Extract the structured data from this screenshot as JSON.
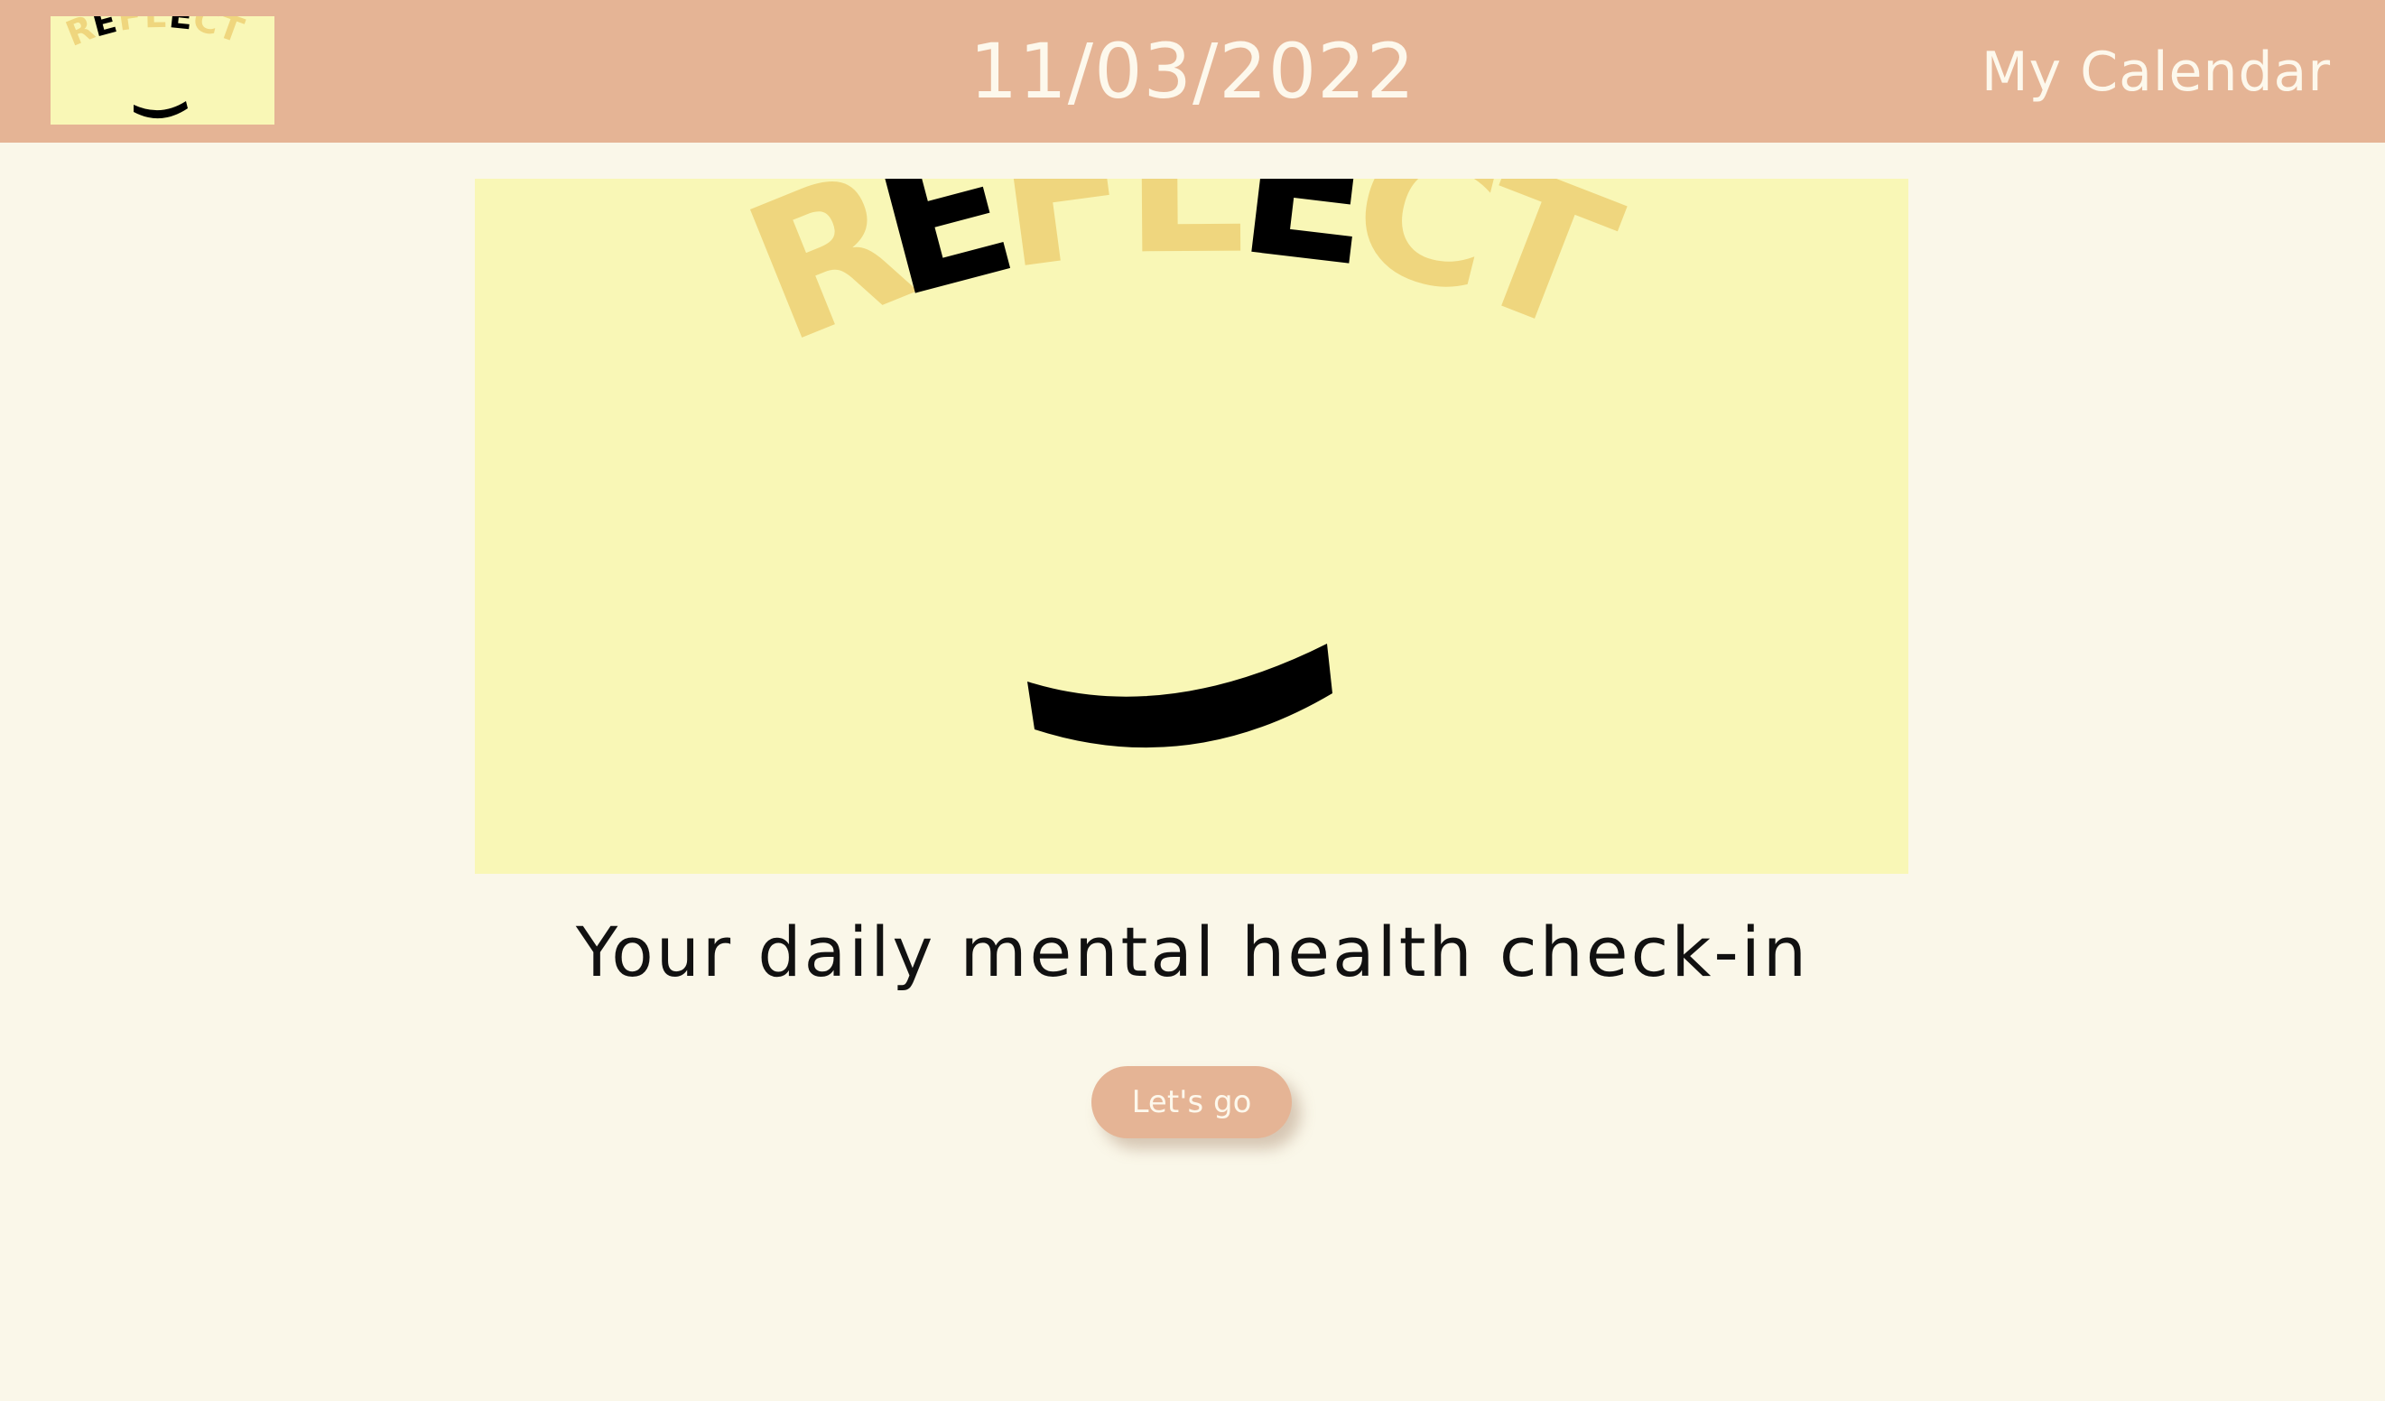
{
  "header": {
    "logo_text": "REFLECT",
    "date": "11/03/2022",
    "calendar_link": "My Calendar"
  },
  "hero": {
    "logo_text": "REFLECT",
    "letters": [
      "R",
      "E",
      "F",
      "L",
      "E",
      "C",
      "T"
    ]
  },
  "main": {
    "tagline": "Your daily mental health check-in",
    "cta_label": "Let's go"
  },
  "colors": {
    "header_bg": "#e5b495",
    "page_bg": "#faf7e9",
    "hero_bg": "#f9f7b6",
    "letter_light": "#efd67e",
    "letter_dark": "#000000",
    "button_bg": "#e5b495"
  }
}
